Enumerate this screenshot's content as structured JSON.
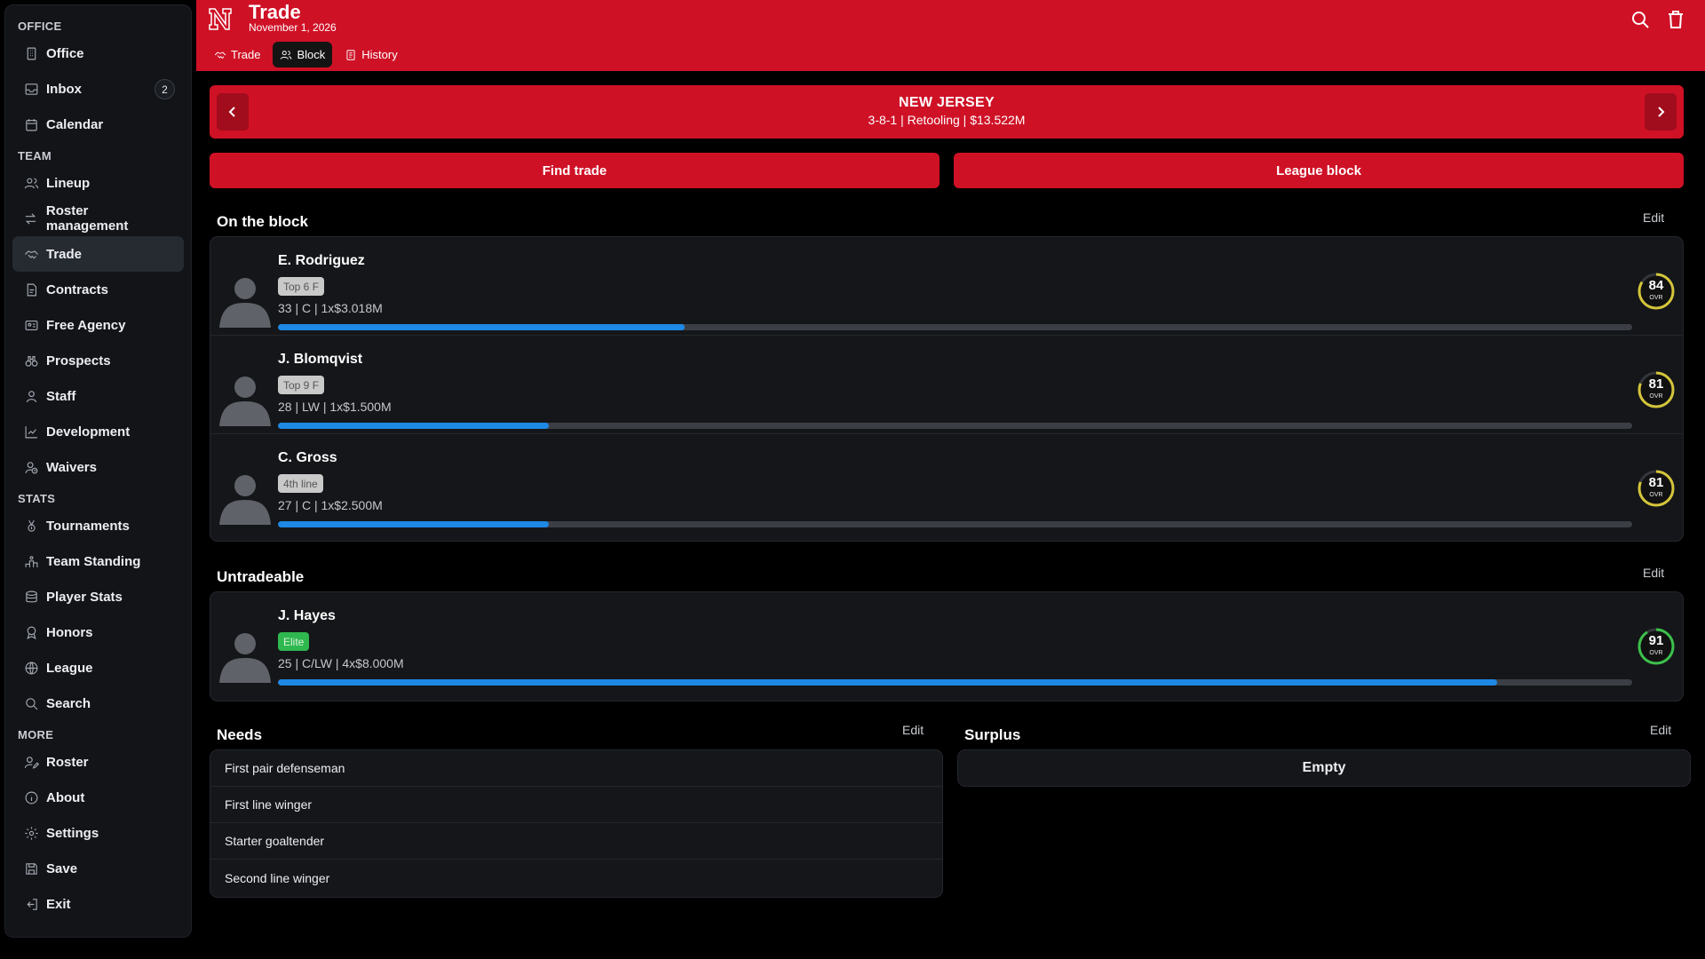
{
  "sidebar": {
    "sections": [
      {
        "title": "OFFICE",
        "items": [
          {
            "label": "Office",
            "icon": "building-icon"
          },
          {
            "label": "Inbox",
            "icon": "inbox-icon",
            "badge": "2"
          },
          {
            "label": "Calendar",
            "icon": "calendar-icon"
          }
        ]
      },
      {
        "title": "TEAM",
        "items": [
          {
            "label": "Lineup",
            "icon": "users-icon"
          },
          {
            "label": "Roster management",
            "icon": "swap-icon"
          },
          {
            "label": "Trade",
            "icon": "handshake-icon",
            "active": true
          },
          {
            "label": "Contracts",
            "icon": "contract-icon"
          },
          {
            "label": "Free Agency",
            "icon": "id-card-icon"
          },
          {
            "label": "Prospects",
            "icon": "binoculars-icon"
          },
          {
            "label": "Staff",
            "icon": "person-icon"
          },
          {
            "label": "Development",
            "icon": "chart-line-icon"
          },
          {
            "label": "Waivers",
            "icon": "user-clock-icon"
          }
        ]
      },
      {
        "title": "STATS",
        "items": [
          {
            "label": "Tournaments",
            "icon": "medal-icon"
          },
          {
            "label": "Team Standing",
            "icon": "podium-icon"
          },
          {
            "label": "Player Stats",
            "icon": "database-icon"
          },
          {
            "label": "Honors",
            "icon": "award-icon"
          },
          {
            "label": "League",
            "icon": "globe-icon"
          },
          {
            "label": "Search",
            "icon": "search-icon"
          }
        ]
      },
      {
        "title": "MORE",
        "items": [
          {
            "label": "Roster",
            "icon": "user-edit-icon"
          },
          {
            "label": "About",
            "icon": "info-icon"
          },
          {
            "label": "Settings",
            "icon": "gear-icon"
          },
          {
            "label": "Save",
            "icon": "save-icon"
          },
          {
            "label": "Exit",
            "icon": "exit-icon"
          }
        ]
      }
    ]
  },
  "header": {
    "title": "Trade",
    "date": "November 1, 2026",
    "tabs": [
      {
        "label": "Trade",
        "icon": "handshake-icon"
      },
      {
        "label": "Block",
        "icon": "users-icon",
        "active": true
      },
      {
        "label": "History",
        "icon": "history-icon"
      }
    ],
    "accent_color": "#cf1126"
  },
  "team": {
    "name": "NEW JERSEY",
    "info": "3-8-1 | Retooling | $13.522M"
  },
  "buttons": {
    "find_trade": "Find trade",
    "league_block": "League block"
  },
  "on_the_block": {
    "title": "On the block",
    "edit": "Edit",
    "players": [
      {
        "name": "E. Rodriguez",
        "tag": "Top 6 F",
        "info": "33 | C | 1x$3.018M",
        "progress": 0.3,
        "ovr": "84",
        "ovr_label": "OVR",
        "ring_color": "#d4c53a"
      },
      {
        "name": "J. Blomqvist",
        "tag": "Top 9 F",
        "info": "28 | LW | 1x$1.500M",
        "progress": 0.2,
        "ovr": "81",
        "ovr_label": "OVR",
        "ring_color": "#d4c53a"
      },
      {
        "name": "C. Gross",
        "tag": "4th line",
        "info": "27 | C | 1x$2.500M",
        "progress": 0.2,
        "ovr": "81",
        "ovr_label": "OVR",
        "ring_color": "#d4c53a"
      }
    ]
  },
  "untradeable": {
    "title": "Untradeable",
    "edit": "Edit",
    "players": [
      {
        "name": "J. Hayes",
        "tag": "Elite",
        "info": "25 | C/LW | 4x$8.000M",
        "progress": 0.9,
        "ovr": "91",
        "ovr_label": "OVR",
        "ring_color": "#3cc04a"
      }
    ]
  },
  "needs": {
    "title": "Needs",
    "edit": "Edit",
    "items": [
      "First pair defenseman",
      "First line winger",
      "Starter goaltender",
      "Second line winger"
    ]
  },
  "surplus": {
    "title": "Surplus",
    "edit": "Edit",
    "empty": "Empty"
  }
}
